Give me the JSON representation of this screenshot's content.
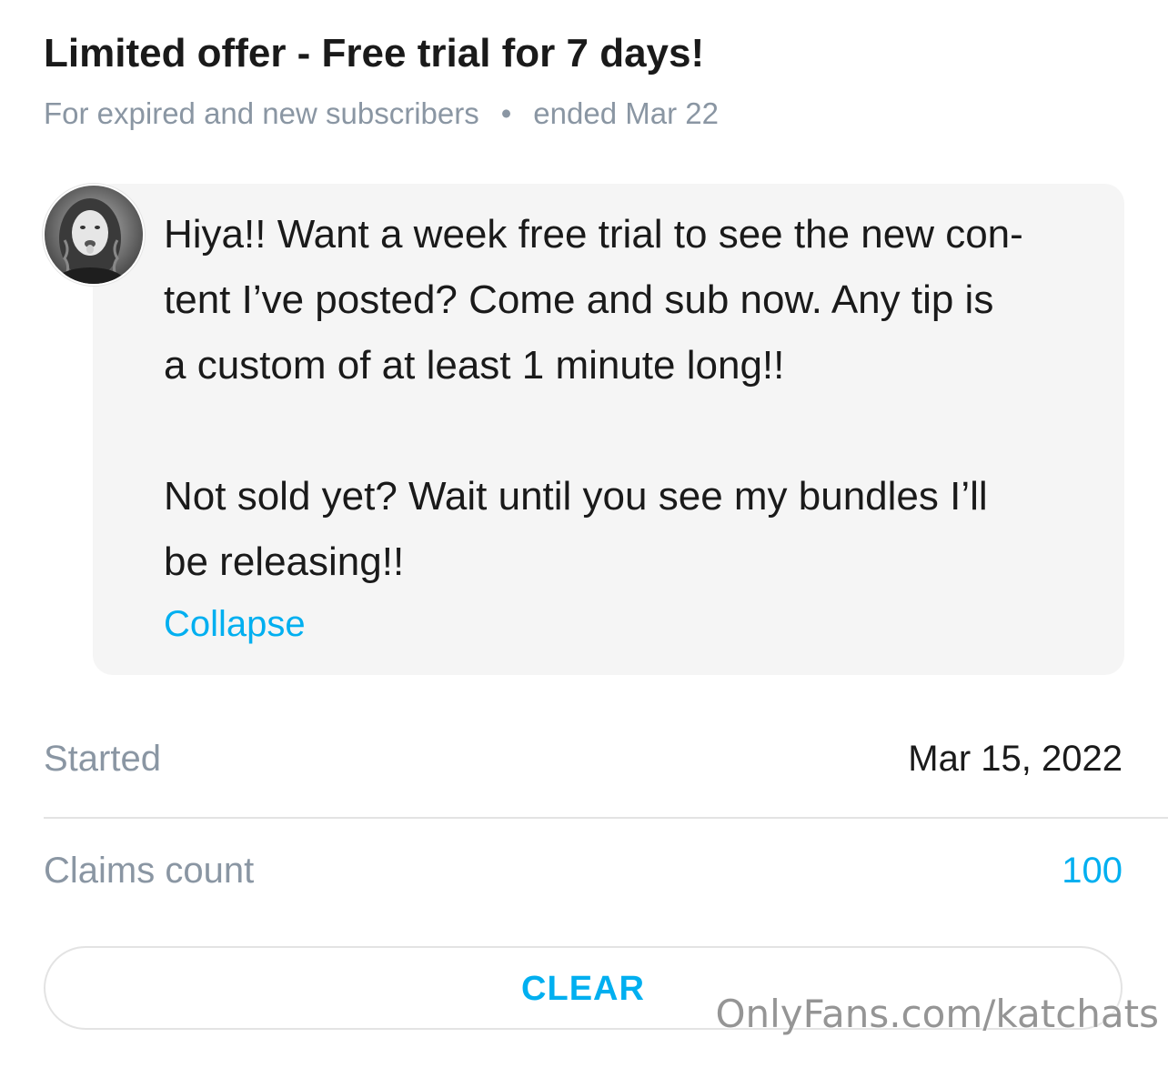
{
  "offer": {
    "title": "Limited offer - Free trial for 7 days!",
    "audience": "For expired and new subscribers",
    "separator": "•",
    "status": "ended Mar 22"
  },
  "message": {
    "avatar_icon": "user-avatar-photo",
    "line1": "Hiya!! Want a week free trial to see the new con-",
    "line2": "tent I’ve posted? Come and sub now. Any tip is",
    "line3": "a custom of at least 1 minute long!!",
    "line4": "Not sold yet? Wait until you see my bundles I’ll",
    "line5": "be releasing!!",
    "collapse_label": "Collapse"
  },
  "details": {
    "started_label": "Started",
    "started_value": "Mar 15, 2022",
    "claims_label": "Claims count",
    "claims_value": "100"
  },
  "actions": {
    "clear_label": "CLEAR"
  },
  "watermark": "OnlyFans.com/katchats",
  "colors": {
    "accent": "#00aff0",
    "muted": "#8a96a3",
    "text": "#1a1a1a",
    "bubble": "#f5f5f5",
    "divider": "#e3e3e3"
  }
}
